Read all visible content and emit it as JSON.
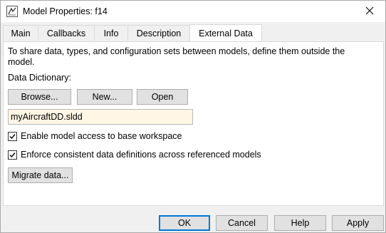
{
  "window": {
    "title": "Model Properties: f14",
    "app_icon": "simulink-model-icon",
    "close_icon": "close-icon"
  },
  "tabs": [
    {
      "label": "Main",
      "active": false
    },
    {
      "label": "Callbacks",
      "active": false
    },
    {
      "label": "Info",
      "active": false
    },
    {
      "label": "Description",
      "active": false
    },
    {
      "label": "External Data",
      "active": true
    }
  ],
  "external_data": {
    "description": "To share data, types, and configuration sets between models, define them outside the model.",
    "dictionary_label": "Data Dictionary:",
    "browse_label": "Browse...",
    "new_label": "New...",
    "open_label": "Open",
    "dictionary_value": "myAircraftDD.sldd",
    "base_workspace_label": "Enable model access to base workspace",
    "base_workspace_checked": true,
    "enforce_label": "Enforce consistent data definitions across referenced models",
    "enforce_checked": true,
    "migrate_label": "Migrate data..."
  },
  "footer": {
    "ok_label": "OK",
    "cancel_label": "Cancel",
    "help_label": "Help",
    "apply_label": "Apply"
  },
  "colors": {
    "field_background": "#fff6e5",
    "default_button_border": "#0078d7"
  }
}
